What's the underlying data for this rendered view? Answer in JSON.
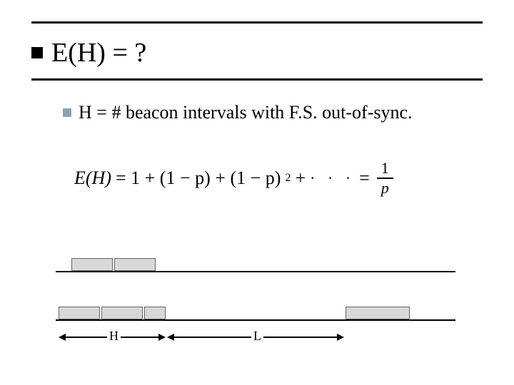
{
  "title": "E(H) = ?",
  "bullet": "H = # beacon intervals with F.S. out-of-sync.",
  "formula": {
    "lhs": "E(H)",
    "eq1": "= 1 + (1 − p) + (1 − p)",
    "exp": "2",
    "plus": " + ",
    "dots": "· · ·",
    "eq2": " = ",
    "frac_num": "1",
    "frac_den": "p"
  },
  "labels": {
    "H": "H",
    "L": "L"
  }
}
